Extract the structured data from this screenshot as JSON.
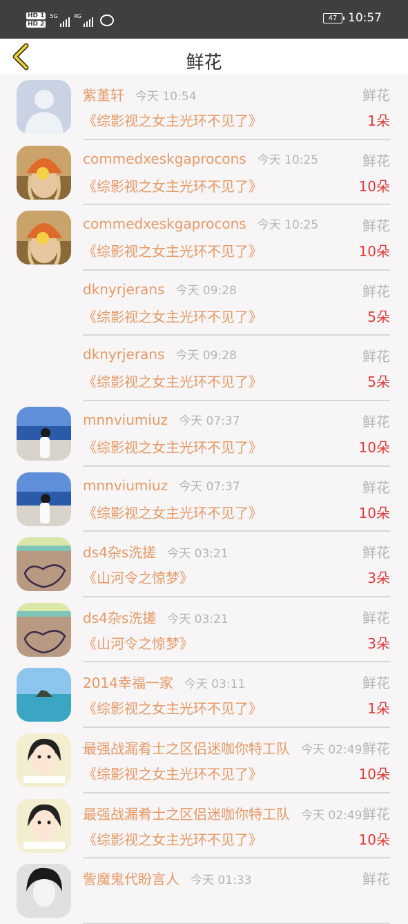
{
  "status_bar": {
    "left": [
      "HD 1",
      "HD 2",
      "5G",
      "4G"
    ],
    "battery": "47",
    "time": "10:57"
  },
  "header": {
    "title": "鲜花"
  },
  "items": [
    {
      "user": "紫堇轩",
      "time": "今天 10:54",
      "gift": "鲜花",
      "book": "《综影视之女主光环不见了》",
      "count": "1朵",
      "avatar": "default"
    },
    {
      "user": "commedxeskgaprocons",
      "time": "今天 10:25",
      "gift": "鲜花",
      "book": "《综影视之女主光环不见了》",
      "count": "10朵",
      "avatar": "orange-hat"
    },
    {
      "user": "commedxeskgaprocons",
      "time": "今天 10:25",
      "gift": "鲜花",
      "book": "《综影视之女主光环不见了》",
      "count": "10朵",
      "avatar": "orange-hat"
    },
    {
      "user": "dknyrjerans",
      "time": "今天 09:28",
      "gift": "鲜花",
      "book": "《综影视之女主光环不见了》",
      "count": "5朵",
      "avatar": "none"
    },
    {
      "user": "dknyrjerans",
      "time": "今天 09:28",
      "gift": "鲜花",
      "book": "《综影视之女主光环不见了》",
      "count": "5朵",
      "avatar": "none"
    },
    {
      "user": "mnnviumiuz",
      "time": "今天 07:37",
      "gift": "鲜花",
      "book": "《综影视之女主光环不见了》",
      "count": "10朵",
      "avatar": "beach-girl"
    },
    {
      "user": "mnnviumiuz",
      "time": "今天 07:37",
      "gift": "鲜花",
      "book": "《综影视之女主光环不见了》",
      "count": "10朵",
      "avatar": "beach-girl"
    },
    {
      "user": "ds4杂s洗搓",
      "time": "今天 03:21",
      "gift": "鲜花",
      "book": "《山河令之惊梦》",
      "count": "3朵",
      "avatar": "sand-heart"
    },
    {
      "user": "ds4杂s洗搓",
      "time": "今天 03:21",
      "gift": "鲜花",
      "book": "《山河令之惊梦》",
      "count": "3朵",
      "avatar": "sand-heart"
    },
    {
      "user": "2014幸福一家",
      "time": "今天 03:11",
      "gift": "鲜花",
      "book": "《综影视之女主光环不见了》",
      "count": "1朵",
      "avatar": "island"
    },
    {
      "user": "最强战漏肴士之区侣迷咖你特工队",
      "time": "今天 02:49",
      "gift": "鲜花",
      "book": "《综影视之女主光环不见了》",
      "count": "10朵",
      "avatar": "cartoon-girl"
    },
    {
      "user": "最强战漏肴士之区侣迷咖你特工队",
      "time": "今天 02:49",
      "gift": "鲜花",
      "book": "《综影视之女主光环不见了》",
      "count": "10朵",
      "avatar": "cartoon-girl"
    },
    {
      "user": "訾魔鬼代盼言人",
      "time": "今天 01:33",
      "gift": "鲜花",
      "book": "",
      "count": "",
      "avatar": "bw-portrait"
    }
  ]
}
